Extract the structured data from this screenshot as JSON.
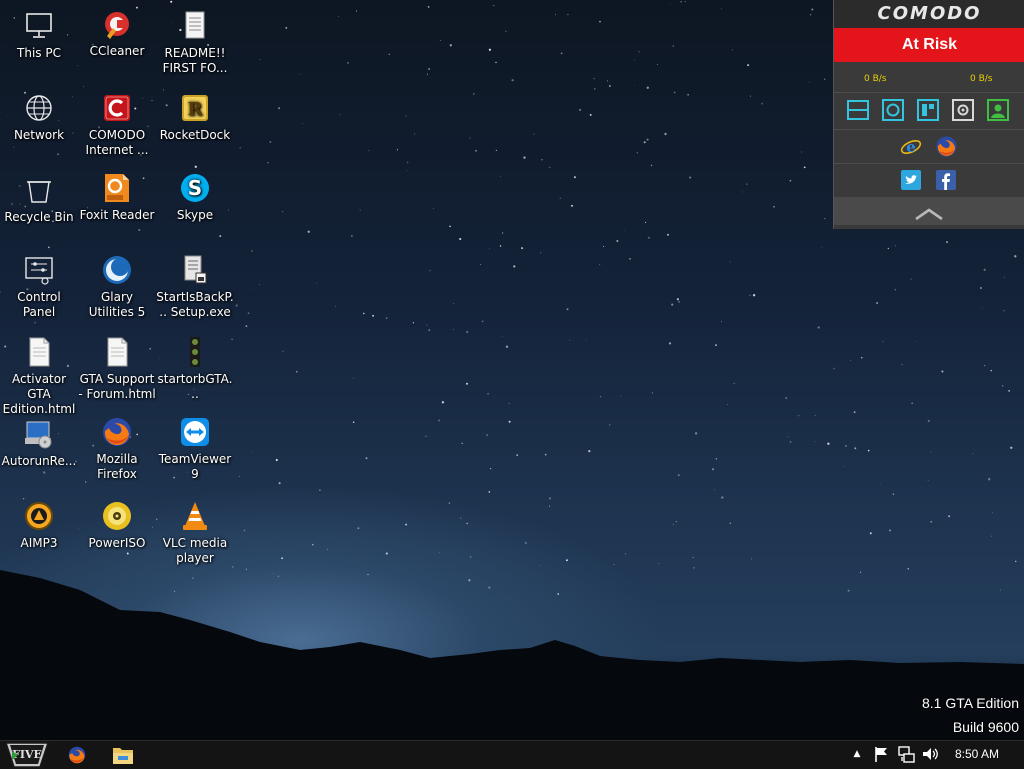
{
  "desktop": {
    "icons": [
      {
        "label": "This PC",
        "icon": "this-pc-icon"
      },
      {
        "label": "CCleaner",
        "icon": "ccleaner-icon"
      },
      {
        "label": "README!! FIRST FO...",
        "icon": "text-document-icon"
      },
      {
        "label": "Network",
        "icon": "network-icon"
      },
      {
        "label": "COMODO Internet ...",
        "icon": "comodo-icon"
      },
      {
        "label": "RocketDock",
        "icon": "rocketdock-icon"
      },
      {
        "label": "Recycle Bin",
        "icon": "recycle-bin-icon"
      },
      {
        "label": "Foxit Reader",
        "icon": "foxit-reader-icon"
      },
      {
        "label": "Skype",
        "icon": "skype-icon"
      },
      {
        "label": "Control Panel",
        "icon": "control-panel-icon"
      },
      {
        "label": "Glary Utilities 5",
        "icon": "glary-utilities-icon"
      },
      {
        "label": "StartIsBackP... Setup.exe",
        "icon": "installer-icon"
      },
      {
        "label": "Activator GTA Edition.html",
        "icon": "html-file-icon"
      },
      {
        "label": "GTA Support - Forum.html",
        "icon": "html-file-icon"
      },
      {
        "label": "startorbGTA...",
        "icon": "startorb-icon"
      },
      {
        "label": "AutorunRe...",
        "icon": "autorun-icon"
      },
      {
        "label": "Mozilla Firefox",
        "icon": "firefox-icon"
      },
      {
        "label": "TeamViewer 9",
        "icon": "teamviewer-icon"
      },
      {
        "label": "AIMP3",
        "icon": "aimp-icon"
      },
      {
        "label": "PowerISO",
        "icon": "poweriso-icon"
      },
      {
        "label": "VLC media player",
        "icon": "vlc-icon"
      }
    ]
  },
  "comodo": {
    "logo": "COMODO",
    "status": "At Risk",
    "download_rate": "0 B/s",
    "upload_rate": "0 B/s",
    "colors": {
      "status_bg": "#e3151a",
      "rate_text": "#e8d000",
      "tool_cyan": "#33c4e0",
      "tool_green": "#3fbf3f"
    }
  },
  "watermark": {
    "edition": "8.1 GTA Edition",
    "build": "Build 9600"
  },
  "taskbar": {
    "start_label": "FIVE",
    "clock": "8:50 AM"
  }
}
